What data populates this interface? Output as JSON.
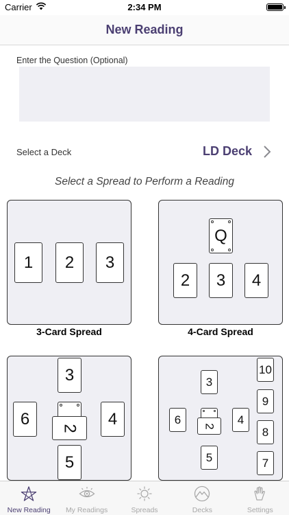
{
  "status": {
    "carrier": "Carrier",
    "time": "2:34 PM"
  },
  "nav": {
    "title": "New Reading"
  },
  "question": {
    "label": "Enter the Question (Optional)",
    "value": "",
    "placeholder": ""
  },
  "deck": {
    "label": "Select a Deck",
    "value": "LD Deck"
  },
  "spreads": {
    "heading": "Select a Spread to Perform a Reading",
    "three_card": {
      "label": "3-Card Spread",
      "cards": [
        "1",
        "2",
        "3"
      ]
    },
    "four_card": {
      "label": "4-Card Spread",
      "cards": [
        "Q",
        "2",
        "3",
        "4"
      ]
    },
    "cross": {
      "cards": [
        "3",
        "6",
        "2",
        "4",
        "5"
      ]
    },
    "celtic": {
      "cards": [
        "3",
        "6",
        "2",
        "4",
        "5",
        "10",
        "9",
        "8",
        "7"
      ]
    }
  },
  "tabs": [
    {
      "label": "New Reading",
      "icon": "pentagram-icon"
    },
    {
      "label": "My Readings",
      "icon": "eye-icon"
    },
    {
      "label": "Spreads",
      "icon": "sun-icon"
    },
    {
      "label": "Decks",
      "icon": "mountain-icon"
    },
    {
      "label": "Settings",
      "icon": "hand-icon"
    }
  ],
  "colors": {
    "accent": "#4b3f72",
    "tile_bg": "#efeff4",
    "inactive_tab": "#a8a8a8"
  }
}
